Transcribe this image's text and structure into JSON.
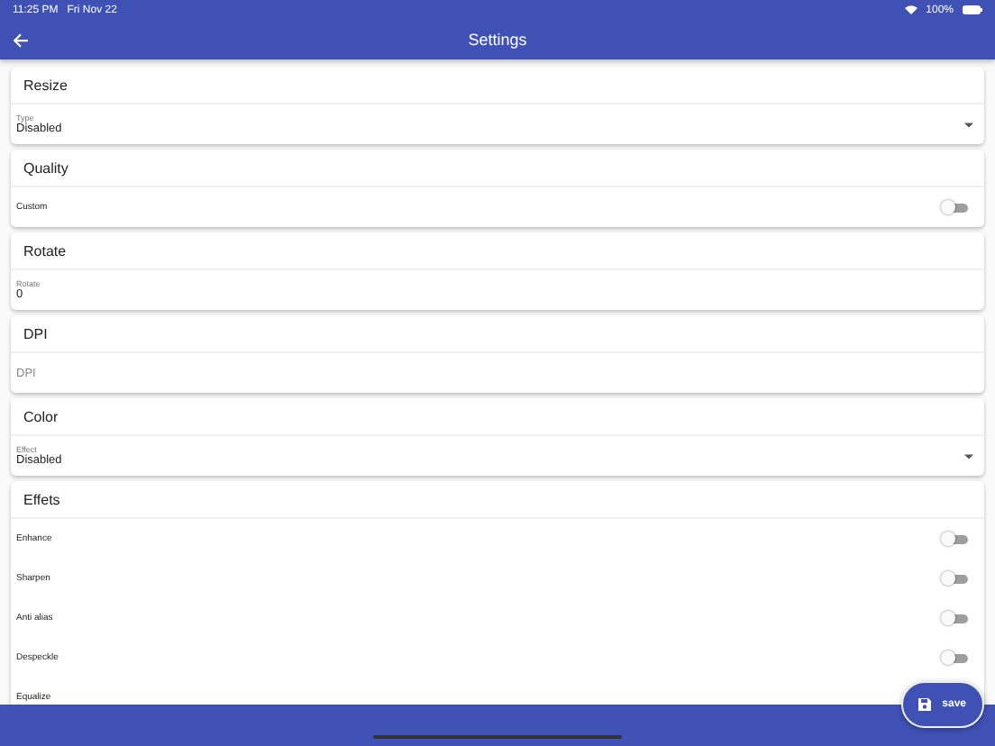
{
  "status_bar": {
    "time": "11:25 PM",
    "date": "Fri Nov 22",
    "battery": "100%"
  },
  "app_bar": {
    "title": "Settings"
  },
  "cards": [
    {
      "title": "Resize",
      "fields": [
        {
          "kind": "select",
          "label": "Type",
          "value": "Disabled"
        }
      ]
    },
    {
      "title": "Quality",
      "fields": [
        {
          "kind": "toggle",
          "label": "Custom",
          "checked": false
        }
      ]
    },
    {
      "title": "Rotate",
      "fields": [
        {
          "kind": "input",
          "label": "Rotate",
          "value": "0"
        }
      ]
    },
    {
      "title": "DPI",
      "fields": [
        {
          "kind": "input",
          "placeholder": "DPI"
        }
      ]
    },
    {
      "title": "Color",
      "fields": [
        {
          "kind": "select",
          "label": "Effect",
          "value": "Disabled"
        }
      ]
    },
    {
      "title": "Effets",
      "fields": [
        {
          "kind": "toggle",
          "label": "Enhance",
          "checked": false
        },
        {
          "kind": "toggle",
          "label": "Sharpen",
          "checked": false
        },
        {
          "kind": "toggle",
          "label": "Anti alias",
          "checked": false
        },
        {
          "kind": "toggle",
          "label": "Despeckle",
          "checked": false
        },
        {
          "kind": "label",
          "label": "Equalize"
        }
      ]
    }
  ],
  "save_button": {
    "label": "save"
  }
}
